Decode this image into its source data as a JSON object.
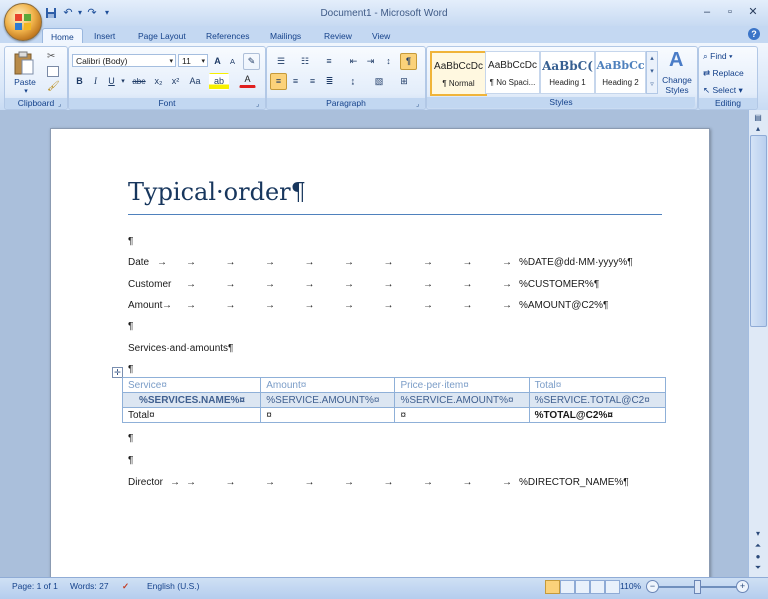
{
  "window": {
    "title": "Document1 - Microsoft Word",
    "minimize": "–",
    "maximize": "▫",
    "close": "✕"
  },
  "qat": {
    "save_icon": "💾",
    "undo_icon": "↶",
    "redo_icon": "↷",
    "customize_icon": "▾"
  },
  "tabs": [
    {
      "label": "Home",
      "active": true
    },
    {
      "label": "Insert"
    },
    {
      "label": "Page Layout"
    },
    {
      "label": "References"
    },
    {
      "label": "Mailings"
    },
    {
      "label": "Review"
    },
    {
      "label": "View"
    }
  ],
  "help": "?",
  "ribbon": {
    "clipboard": {
      "label": "Clipboard",
      "paste": "Paste"
    },
    "font": {
      "label": "Font",
      "font_name": "Calibri (Body)",
      "font_size": "11",
      "bold": "B",
      "italic": "I",
      "underline": "U",
      "strike": "abe",
      "sub": "x₂",
      "sup": "x²",
      "case": "Aa",
      "grow": "A",
      "shrink": "A",
      "color": "A"
    },
    "paragraph": {
      "label": "Paragraph",
      "pilcrow": "¶"
    },
    "styles": {
      "label": "Styles",
      "items": [
        {
          "sample": "AaBbCcDc",
          "name": "¶ Normal"
        },
        {
          "sample": "AaBbCcDc",
          "name": "¶ No Spaci..."
        },
        {
          "sample": "AaBbC(",
          "name": "Heading 1"
        },
        {
          "sample": "AaBbCc",
          "name": "Heading 2"
        }
      ],
      "change_styles": "Change Styles"
    },
    "editing": {
      "label": "Editing",
      "find": "Find",
      "replace": "Replace",
      "select": "Select"
    }
  },
  "document": {
    "heading": "Typical·order¶",
    "pilcrow": "¶",
    "rows": [
      {
        "label": "Date",
        "value": "%DATE@dd·MM·yyyy%¶"
      },
      {
        "label": "Customer",
        "value": "%CUSTOMER%¶"
      },
      {
        "label": "Amount",
        "value": "%AMOUNT@C2%¶"
      }
    ],
    "services_heading": "Services·and·amounts¶",
    "table": {
      "header": [
        "Service¤",
        "Amount¤",
        "Price·per·item¤",
        "Total¤"
      ],
      "service_row": [
        "%SERVICES.NAME%¤",
        "%SERVICE.AMOUNT%¤",
        "%SERVICE.AMOUNT%¤",
        "%SERVICE.TOTAL@C2¤"
      ],
      "total_row": [
        "Total¤",
        "¤",
        "¤",
        "%TOTAL@C2%¤"
      ]
    },
    "director": {
      "label": "Director",
      "value": "%DIRECTOR_NAME%¶"
    },
    "tab_arrow": "→"
  },
  "status": {
    "page": "Page: 1 of 1",
    "words": "Words: 27",
    "language": "English (U.S.)",
    "zoom": "110%"
  }
}
